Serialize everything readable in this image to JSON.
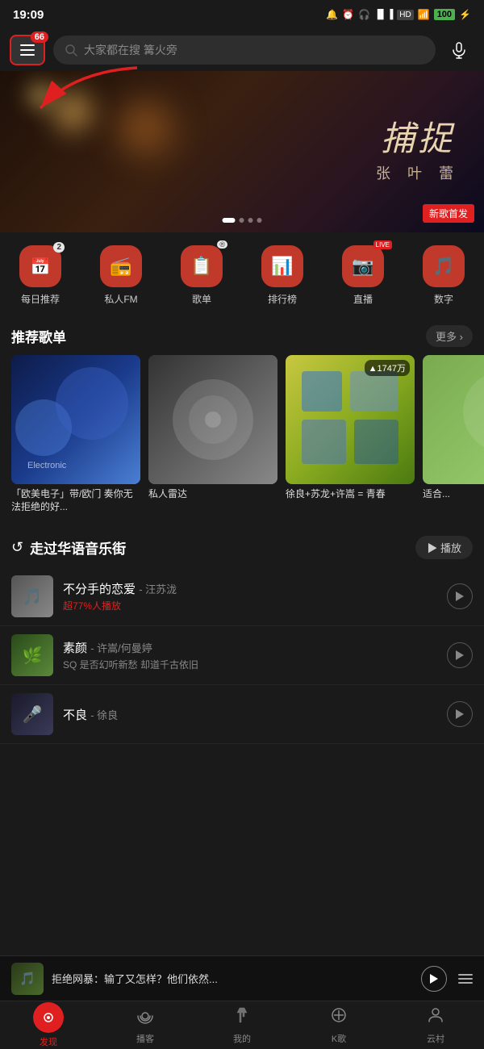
{
  "statusBar": {
    "time": "19:09",
    "battery": "100",
    "batteryLabel": "100"
  },
  "header": {
    "badgeCount": "66",
    "searchPlaceholder": "大家都在搜 篝火旁",
    "menuIcon": "≡"
  },
  "banner": {
    "title": "捕捉",
    "artist": "张 叶 蕾",
    "newTag": "新歌首发"
  },
  "quickIcons": [
    {
      "id": "daily",
      "icon": "📅",
      "label": "每日推荐",
      "badge": "2"
    },
    {
      "id": "fm",
      "icon": "📻",
      "label": "私人FM",
      "badge": ""
    },
    {
      "id": "playlist",
      "icon": "📋",
      "label": "歌单",
      "badge": "®"
    },
    {
      "id": "chart",
      "icon": "📊",
      "label": "排行榜",
      "badge": ""
    },
    {
      "id": "live",
      "icon": "📷",
      "label": "直播",
      "badge": "LIVE"
    },
    {
      "id": "digital",
      "icon": "🎵",
      "label": "数字",
      "badge": ""
    }
  ],
  "recommendSection": {
    "title": "推荐歌单",
    "moreLabel": "更多 ›"
  },
  "playlists": [
    {
      "id": 1,
      "title": "「欧美电子」带/欧门 奏你无法拒绝的好...",
      "playCount": "",
      "thumbType": "blue"
    },
    {
      "id": 2,
      "title": "私人雷达",
      "playCount": "",
      "thumbType": "grey"
    },
    {
      "id": 3,
      "title": "徐良+苏龙+许嵩 = 青春",
      "playCount": "1747万",
      "thumbType": "green"
    },
    {
      "id": 4,
      "title": "适合...",
      "playCount": "",
      "thumbType": "teal"
    }
  ],
  "streetSection": {
    "icon": "↺",
    "title": "走过华语音乐街",
    "playAllLabel": "▶ 播放"
  },
  "songs": [
    {
      "id": 1,
      "name": "不分手的恋爱",
      "artist": "汪苏泷",
      "sub": "超77%人播放",
      "thumbType": "grey2"
    },
    {
      "id": 2,
      "name": "素颜",
      "artist": "许嵩/何曼婷",
      "sub": "SQ 是否幻听新愁 却道千古依旧",
      "thumbType": "green2",
      "sqBadge": "SQ"
    },
    {
      "id": 3,
      "name": "不良",
      "artist": "徐良",
      "sub": "",
      "thumbType": "dark"
    }
  ],
  "miniPlayer": {
    "title": "拒绝网暴：输了又怎样？他们依然..."
  },
  "bottomNav": [
    {
      "id": "discover",
      "icon": "⊙",
      "label": "发现",
      "active": true
    },
    {
      "id": "podcast",
      "icon": "((·))",
      "label": "播客",
      "active": false
    },
    {
      "id": "mine",
      "icon": "♪",
      "label": "我的",
      "active": false
    },
    {
      "id": "ksong",
      "icon": "🔍",
      "label": "K歌",
      "active": false
    },
    {
      "id": "village",
      "icon": "👤",
      "label": "云村",
      "active": false
    }
  ]
}
